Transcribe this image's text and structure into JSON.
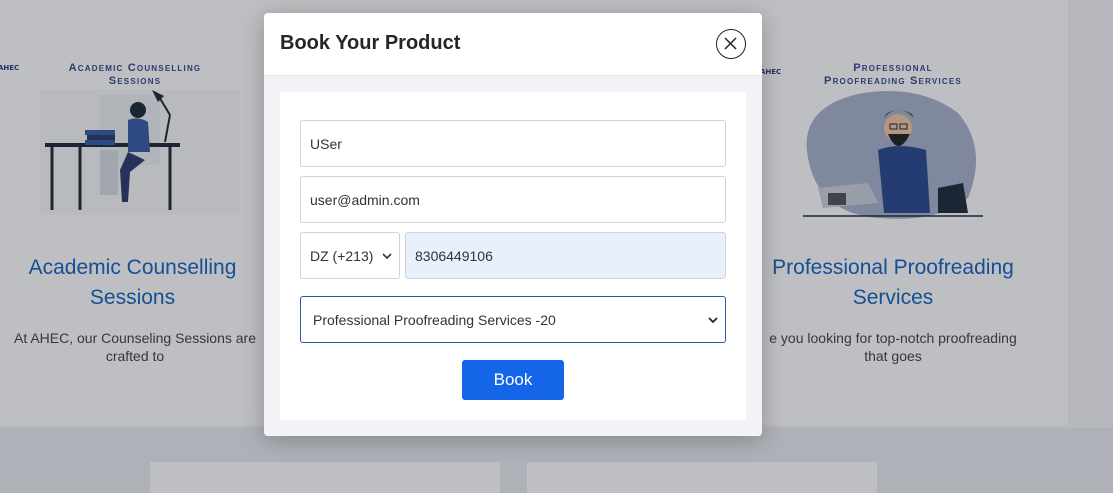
{
  "background": {
    "left_card": {
      "logo": "AHEC",
      "banner_caption_line1": "Academic Counselling",
      "banner_caption_line2": "Sessions",
      "title_line1": "Academic Counselling",
      "title_line2": "Sessions",
      "desc_line1": "At AHEC, our Counseling Sessions are",
      "desc_line2": "crafted to"
    },
    "right_card": {
      "logo": "AHEC",
      "banner_caption_line1": "Professional",
      "banner_caption_line2": "Proofreading Services",
      "title_line1": "Professional Proofreading",
      "title_line2": "Services",
      "desc_line1": "e you looking for top-notch proofreading",
      "desc_line2": "that goes"
    }
  },
  "modal": {
    "title": "Book Your Product",
    "close_icon": "close-icon",
    "form": {
      "name_value": "USer",
      "email_value": "user@admin.com",
      "country_code": "DZ (+213)",
      "phone_value": "8306449106",
      "product_selected": "Professional Proofreading Services -20",
      "book_label": "Book"
    }
  },
  "colors": {
    "primary": "#1565e8",
    "title_blue": "#1565c0",
    "select_border": "#2c5aa0",
    "autofill_bg": "#e8f0fe"
  }
}
